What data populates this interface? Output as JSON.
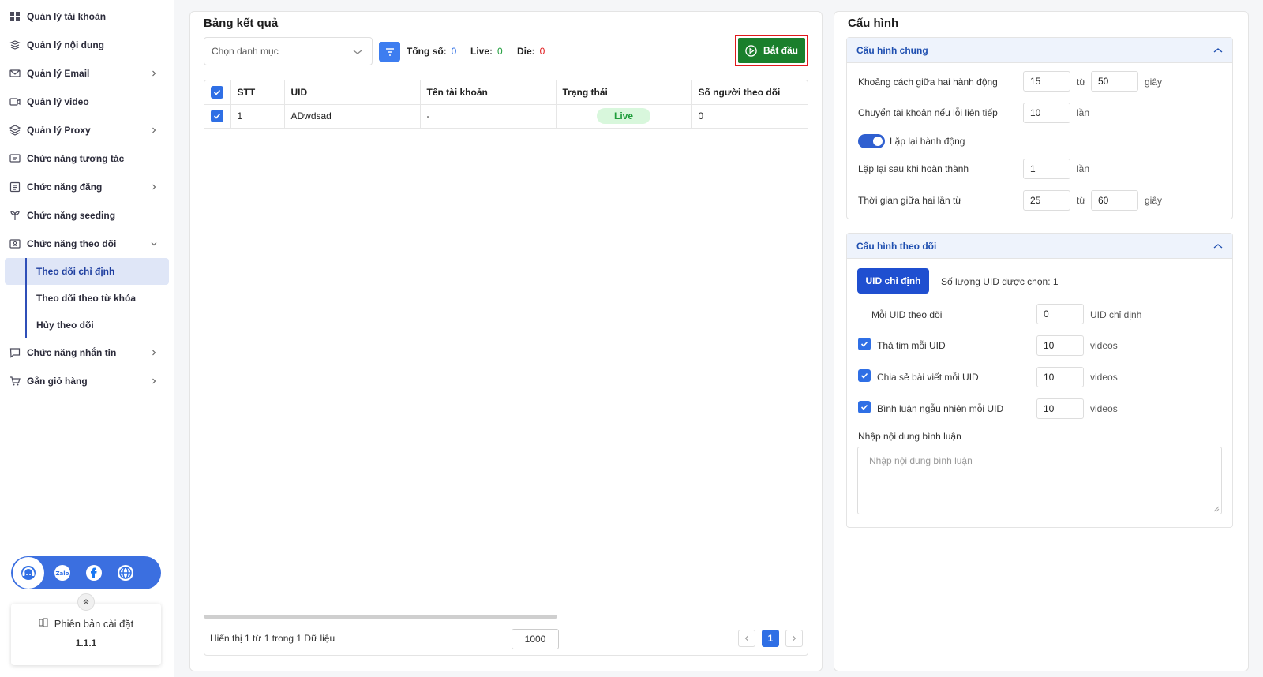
{
  "sidebar": {
    "items": [
      {
        "label": "Quản lý tài khoản",
        "icon": "grid-icon",
        "chevron": false
      },
      {
        "label": "Quản lý nội dung",
        "icon": "layers-icon",
        "chevron": false
      },
      {
        "label": "Quản lý Email",
        "icon": "mail-icon",
        "chevron": true
      },
      {
        "label": "Quản lý video",
        "icon": "video-icon",
        "chevron": false
      },
      {
        "label": "Quản lý Proxy",
        "icon": "stack-icon",
        "chevron": true
      },
      {
        "label": "Chức năng tương tác",
        "icon": "interact-icon",
        "chevron": false
      },
      {
        "label": "Chức năng đăng",
        "icon": "post-icon",
        "chevron": true
      },
      {
        "label": "Chức năng seeding",
        "icon": "seeding-icon",
        "chevron": false
      },
      {
        "label": "Chức năng theo dõi",
        "icon": "follow-icon",
        "chevron": true
      }
    ],
    "sub_items": [
      {
        "label": "Theo dõi chỉ định",
        "active": true
      },
      {
        "label": "Theo dõi theo từ khóa",
        "active": false
      },
      {
        "label": "Hủy theo dõi",
        "active": false
      }
    ],
    "items_after": [
      {
        "label": "Chức năng nhắn tin",
        "icon": "message-icon",
        "chevron": true
      },
      {
        "label": "Gắn giỏ hàng",
        "icon": "cart-icon",
        "chevron": true
      }
    ],
    "version_title": "Phiên bản cài đặt",
    "version_number": "1.1.1"
  },
  "results": {
    "title": "Bảng kết quả",
    "category_placeholder": "Chọn danh mục",
    "total_label": "Tổng số:",
    "total_value": "0",
    "live_label": "Live:",
    "live_value": "0",
    "die_label": "Die:",
    "die_value": "0",
    "start_label": "Bắt đầu",
    "columns": [
      "STT",
      "UID",
      "Tên tài khoản",
      "Trạng thái",
      "Số người theo dõi"
    ],
    "rows": [
      {
        "stt": "1",
        "uid": "ADwdsad",
        "name": "-",
        "status": "Live",
        "followers": "0"
      }
    ],
    "footer_text": "Hiển thị 1 từ 1 trong 1 Dữ liệu",
    "page_size": "1000",
    "current_page": "1"
  },
  "config": {
    "title": "Cấu hình",
    "general": {
      "title": "Cấu hình chung",
      "delay_label": "Khoảng cách giữa hai hành động",
      "delay_from": "15",
      "delay_to": "50",
      "switch_label": "Chuyển tài khoản nếu lỗi liên tiếp",
      "switch_value": "10",
      "repeat_toggle_label": "Lặp lại hành động",
      "repeat_after_label": "Lặp lại sau khi hoàn thành",
      "repeat_after_value": "1",
      "interval_label": "Thời gian giữa hai lần từ",
      "interval_from": "25",
      "interval_to": "60",
      "unit_from": "từ",
      "unit_seconds": "giây",
      "unit_times": "lần"
    },
    "follow": {
      "title": "Cấu hình theo dõi",
      "uid_button": "UID chỉ định",
      "selected_count": "Số lượng UID được chọn: 1",
      "per_uid_label": "Mỗi UID theo dõi",
      "per_uid_value": "0",
      "per_uid_unit": "UID chỉ định",
      "heart_label": "Thả tim mỗi UID",
      "heart_value": "10",
      "share_label": "Chia sẻ bài viết mỗi UID",
      "share_value": "10",
      "comment_label": "Bình luận ngẫu nhiên mỗi UID",
      "comment_value": "10",
      "videos_unit": "videos",
      "comment_content_label": "Nhập nội dung bình luận",
      "comment_placeholder": "Nhập nội dung bình luận"
    }
  }
}
